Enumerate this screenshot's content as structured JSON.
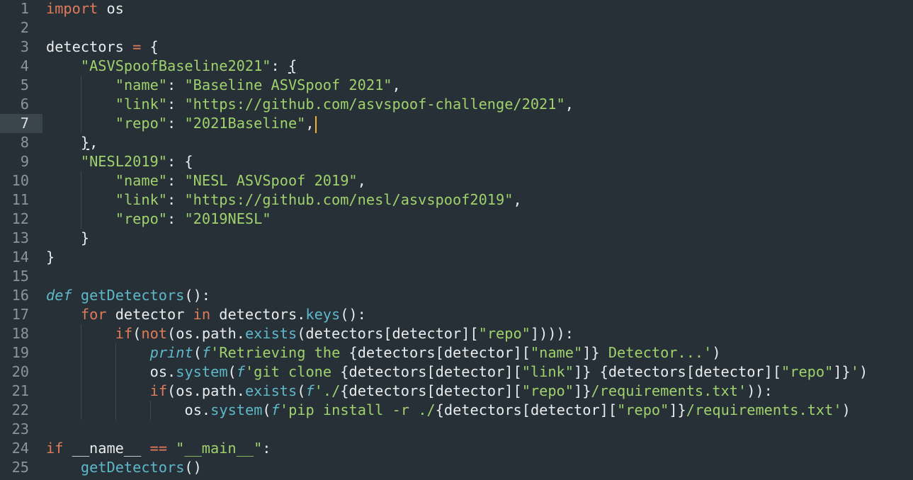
{
  "editor": {
    "active_line": 7,
    "caret_color": "#f2b134",
    "background": "#273036",
    "lines": [
      {
        "n": "1",
        "indent": 0,
        "tokens": [
          [
            "kw",
            "import"
          ],
          [
            "pl",
            " os"
          ]
        ]
      },
      {
        "n": "2",
        "indent": 0,
        "tokens": []
      },
      {
        "n": "3",
        "indent": 0,
        "tokens": [
          [
            "pl",
            "detectors "
          ],
          [
            "kw",
            "="
          ],
          [
            "pl",
            " {"
          ]
        ]
      },
      {
        "n": "4",
        "indent": 1,
        "tokens": [
          [
            "str",
            "\"ASVSpoofBaseline2021\""
          ],
          [
            "pl",
            ": "
          ],
          [
            "pl ul",
            "{"
          ]
        ]
      },
      {
        "n": "5",
        "indent": 2,
        "tokens": [
          [
            "str",
            "\"name\""
          ],
          [
            "pl",
            ": "
          ],
          [
            "str",
            "\"Baseline ASVSpoof 2021\""
          ],
          [
            "pl",
            ","
          ]
        ]
      },
      {
        "n": "6",
        "indent": 2,
        "tokens": [
          [
            "str",
            "\"link\""
          ],
          [
            "pl",
            ": "
          ],
          [
            "str",
            "\"https://github.com/asvspoof-challenge/2021\""
          ],
          [
            "pl",
            ","
          ]
        ]
      },
      {
        "n": "7",
        "indent": 2,
        "tokens": [
          [
            "str",
            "\"repo\""
          ],
          [
            "pl",
            ": "
          ],
          [
            "str",
            "\"2021Baseline\""
          ],
          [
            "pl",
            ","
          ]
        ],
        "caret": true
      },
      {
        "n": "8",
        "indent": 1,
        "tokens": [
          [
            "pl ul",
            "}"
          ],
          [
            "pl",
            ","
          ]
        ]
      },
      {
        "n": "9",
        "indent": 1,
        "tokens": [
          [
            "str",
            "\"NESL2019\""
          ],
          [
            "pl",
            ": {"
          ]
        ]
      },
      {
        "n": "10",
        "indent": 2,
        "tokens": [
          [
            "str",
            "\"name\""
          ],
          [
            "pl",
            ": "
          ],
          [
            "str",
            "\"NESL ASVSpoof 2019\""
          ],
          [
            "pl",
            ","
          ]
        ]
      },
      {
        "n": "11",
        "indent": 2,
        "tokens": [
          [
            "str",
            "\"link\""
          ],
          [
            "pl",
            ": "
          ],
          [
            "str",
            "\"https://github.com/nesl/asvspoof2019\""
          ],
          [
            "pl",
            ","
          ]
        ]
      },
      {
        "n": "12",
        "indent": 2,
        "tokens": [
          [
            "str",
            "\"repo\""
          ],
          [
            "pl",
            ": "
          ],
          [
            "str",
            "\"2019NESL\""
          ]
        ]
      },
      {
        "n": "13",
        "indent": 1,
        "tokens": [
          [
            "pl",
            "}"
          ]
        ]
      },
      {
        "n": "14",
        "indent": 0,
        "tokens": [
          [
            "pl",
            "}"
          ]
        ]
      },
      {
        "n": "15",
        "indent": 0,
        "tokens": []
      },
      {
        "n": "16",
        "indent": 0,
        "tokens": [
          [
            "def",
            "def"
          ],
          [
            "pl",
            " "
          ],
          [
            "fn",
            "getDetectors"
          ],
          [
            "pl",
            "():"
          ]
        ]
      },
      {
        "n": "17",
        "indent": 1,
        "tokens": [
          [
            "kw",
            "for"
          ],
          [
            "pl",
            " detector "
          ],
          [
            "kw",
            "in"
          ],
          [
            "pl",
            " detectors."
          ],
          [
            "fn",
            "keys"
          ],
          [
            "pl",
            "():"
          ]
        ]
      },
      {
        "n": "18",
        "indent": 2,
        "tokens": [
          [
            "kw",
            "if"
          ],
          [
            "pl",
            "("
          ],
          [
            "kw",
            "not"
          ],
          [
            "pl",
            "(os.path."
          ],
          [
            "fn",
            "exists"
          ],
          [
            "pl",
            "(detectors[detector]["
          ],
          [
            "str",
            "\"repo\""
          ],
          [
            "pl",
            "]))):"
          ]
        ]
      },
      {
        "n": "19",
        "indent": 3,
        "tokens": [
          [
            "it",
            "print"
          ],
          [
            "pl",
            "("
          ],
          [
            "it",
            "f"
          ],
          [
            "str",
            "'Retrieving the "
          ],
          [
            "pl",
            "{detectors[detector]["
          ],
          [
            "str",
            "\"name\""
          ],
          [
            "pl",
            "]}"
          ],
          [
            "str",
            " Detector...'"
          ],
          [
            "pl",
            ")"
          ]
        ]
      },
      {
        "n": "20",
        "indent": 3,
        "tokens": [
          [
            "pl",
            "os."
          ],
          [
            "fn",
            "system"
          ],
          [
            "pl",
            "("
          ],
          [
            "it",
            "f"
          ],
          [
            "str",
            "'git clone "
          ],
          [
            "pl",
            "{detectors[detector]["
          ],
          [
            "str",
            "\"link\""
          ],
          [
            "pl",
            "]} {detectors[detector]["
          ],
          [
            "str",
            "\"repo\""
          ],
          [
            "pl",
            "]}"
          ],
          [
            "str",
            "'"
          ],
          [
            "pl",
            ")"
          ]
        ]
      },
      {
        "n": "21",
        "indent": 3,
        "tokens": [
          [
            "kw",
            "if"
          ],
          [
            "pl",
            "(os.path."
          ],
          [
            "fn",
            "exists"
          ],
          [
            "pl",
            "("
          ],
          [
            "it",
            "f"
          ],
          [
            "str",
            "'./"
          ],
          [
            "pl",
            "{detectors[detector]["
          ],
          [
            "str",
            "\"repo\""
          ],
          [
            "pl",
            "]}"
          ],
          [
            "str",
            "/requirements.txt'"
          ],
          [
            "pl",
            "))"
          ],
          [
            "pl",
            ":"
          ]
        ]
      },
      {
        "n": "22",
        "indent": 4,
        "tokens": [
          [
            "pl",
            "os."
          ],
          [
            "fn",
            "system"
          ],
          [
            "pl",
            "("
          ],
          [
            "it",
            "f"
          ],
          [
            "str",
            "'pip install -r ./"
          ],
          [
            "pl",
            "{detectors[detector]["
          ],
          [
            "str",
            "\"repo\""
          ],
          [
            "pl",
            "]}"
          ],
          [
            "str",
            "/requirements.txt'"
          ],
          [
            "pl",
            ")"
          ]
        ]
      },
      {
        "n": "23",
        "indent": 0,
        "tokens": []
      },
      {
        "n": "24",
        "indent": 0,
        "tokens": [
          [
            "kw",
            "if"
          ],
          [
            "pl",
            " __name__ "
          ],
          [
            "kw",
            "=="
          ],
          [
            "pl",
            " "
          ],
          [
            "str",
            "\"__main__\""
          ],
          [
            "pl",
            ":"
          ]
        ]
      },
      {
        "n": "25",
        "indent": 1,
        "tokens": [
          [
            "fn",
            "getDetectors"
          ],
          [
            "pl",
            "()"
          ]
        ]
      }
    ]
  }
}
